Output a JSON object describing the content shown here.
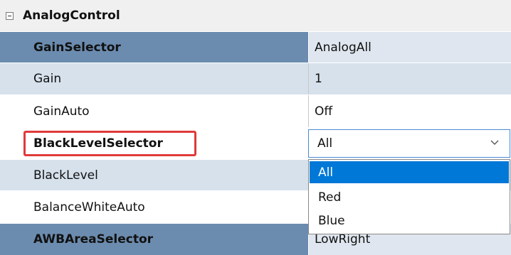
{
  "category": {
    "label": "AnalogControl",
    "toggle_icon": "collapse-minus-icon"
  },
  "rows": [
    {
      "name": "GainSelector",
      "value": "AnalogAll"
    },
    {
      "name": "Gain",
      "value": "1"
    },
    {
      "name": "GainAuto",
      "value": "Off"
    },
    {
      "name": "BlackLevelSelector",
      "value": "All"
    },
    {
      "name": "BlackLevel",
      "value": ""
    },
    {
      "name": "BalanceWhiteAuto",
      "value": ""
    },
    {
      "name": "AWBAreaSelector",
      "value": "LowRight"
    }
  ],
  "dropdown": {
    "options": [
      "All",
      "Red",
      "Blue"
    ],
    "selected": "All",
    "chevron_icon": "chevron-down-icon"
  },
  "colors": {
    "selected_row": "#6b8caf",
    "alt_row": "#d6e1ec",
    "highlight_border": "#e03a3a",
    "dropdown_selected": "#0078d7"
  }
}
